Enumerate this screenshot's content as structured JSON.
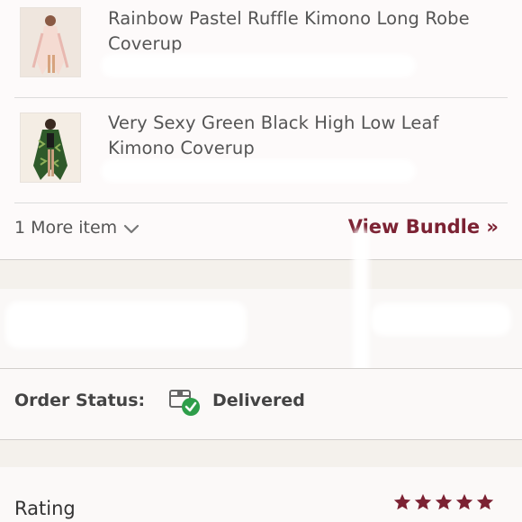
{
  "items": [
    {
      "title": "Rainbow Pastel Ruffle Kimono Long Robe Coverup",
      "thumbnail": "kimono-robe-photo"
    },
    {
      "title": "Very Sexy Green Black High Low Leaf Kimono Coverup",
      "thumbnail": "green-leaf-kimono-photo"
    }
  ],
  "more_items": {
    "label": "1 More item",
    "icon": "chevron-down-icon"
  },
  "view_bundle": {
    "label": "View Bundle »"
  },
  "order_status": {
    "label": "Order Status:",
    "value": "Delivered",
    "icon": "package-delivered-icon",
    "check_color": "#2e9e4a"
  },
  "rating": {
    "label": "Rating",
    "stars": 5,
    "max": 5,
    "star_color": "#7c2233"
  }
}
